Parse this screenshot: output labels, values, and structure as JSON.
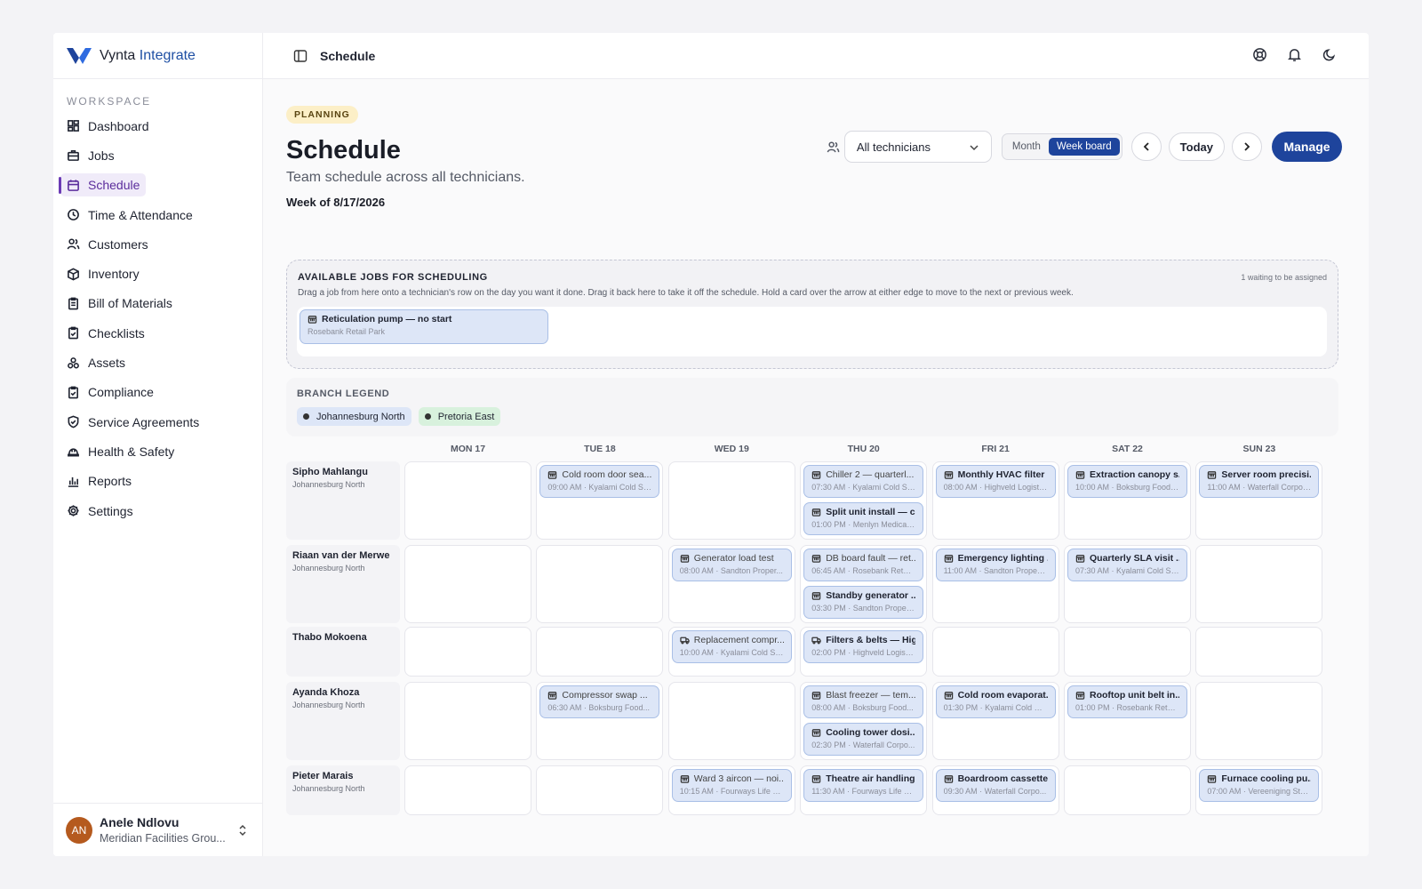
{
  "brand": {
    "name_main": "Vynta",
    "name_accent": "Integrate"
  },
  "sidebar": {
    "section_label": "WORKSPACE",
    "items": [
      {
        "label": "Dashboard",
        "icon": "dashboard-icon"
      },
      {
        "label": "Jobs",
        "icon": "briefcase-icon"
      },
      {
        "label": "Schedule",
        "icon": "calendar-icon",
        "active": true
      },
      {
        "label": "Time & Attendance",
        "icon": "clock-icon"
      },
      {
        "label": "Customers",
        "icon": "users-icon"
      },
      {
        "label": "Inventory",
        "icon": "box-icon"
      },
      {
        "label": "Bill of Materials",
        "icon": "clipboard-list-icon"
      },
      {
        "label": "Checklists",
        "icon": "clipboard-check-icon"
      },
      {
        "label": "Assets",
        "icon": "assets-icon"
      },
      {
        "label": "Compliance",
        "icon": "clipboard-check-icon"
      },
      {
        "label": "Service Agreements",
        "icon": "shield-check-icon"
      },
      {
        "label": "Health & Safety",
        "icon": "hard-hat-icon"
      },
      {
        "label": "Reports",
        "icon": "bar-chart-icon"
      },
      {
        "label": "Settings",
        "icon": "gear-icon"
      }
    ],
    "user": {
      "initials": "AN",
      "name": "Anele Ndlovu",
      "org": "Meridian Facilities Grou..."
    }
  },
  "topbar": {
    "title": "Schedule"
  },
  "page": {
    "badge": "PLANNING",
    "title": "Schedule",
    "subtitle": "Team schedule across all technicians.",
    "week": "Week of 8/17/2026"
  },
  "controls": {
    "technician_filter": "All technicians",
    "view_month": "Month",
    "view_week": "Week board",
    "today": "Today",
    "manage": "Manage"
  },
  "available": {
    "title": "AVAILABLE JOBS FOR SCHEDULING",
    "count": "1 waiting to be assigned",
    "description": "Drag a job from here onto a technician's row on the day you want it done. Drag it back here to take it off the schedule. Hold a card over the arrow at either edge to move to the next or previous week.",
    "jobs": [
      {
        "title": "Reticulation pump — no start",
        "meta": "Rosebank Retail Park"
      }
    ]
  },
  "legend": {
    "title": "BRANCH LEGEND",
    "branches": [
      {
        "name": "Johannesburg North",
        "color": "#dde6f7"
      },
      {
        "name": "Pretoria East",
        "color": "#d8f1dd"
      }
    ]
  },
  "board": {
    "days": [
      "MON 17",
      "TUE 18",
      "WED 19",
      "THU 20",
      "FRI 21",
      "SAT 22",
      "SUN 23"
    ],
    "rows": [
      {
        "name": "Sipho Mahlangu",
        "branch": "Johannesburg North",
        "cells": [
          [],
          [
            {
              "t": "Cold room door sea...",
              "m": "09:00 AM · Kyalami Cold St...",
              "pending": true
            }
          ],
          [],
          [
            {
              "t": "Chiller 2 — quarterl...",
              "m": "07:30 AM · Kyalami Cold St...",
              "pending": true
            },
            {
              "t": "Split unit install — c...",
              "m": "01:00 PM · Menlyn Medical ..."
            }
          ],
          [
            {
              "t": "Monthly HVAC filter ...",
              "m": "08:00 AM · Highveld Logisti..."
            }
          ],
          [
            {
              "t": "Extraction canopy s...",
              "m": "10:00 AM · Boksburg Foods..."
            }
          ],
          [
            {
              "t": "Server room precisi...",
              "m": "11:00 AM · Waterfall Corpor..."
            }
          ]
        ]
      },
      {
        "name": "Riaan van der Merwe",
        "branch": "Johannesburg North",
        "cells": [
          [],
          [],
          [
            {
              "t": "Generator load test",
              "m": "08:00 AM · Sandton Proper...",
              "pending": true
            }
          ],
          [
            {
              "t": "DB board fault — ret...",
              "m": "06:45 AM · Rosebank Retail...",
              "pending": true
            },
            {
              "t": "Standby generator ...",
              "m": "03:30 PM · Sandton Propert..."
            }
          ],
          [
            {
              "t": "Emergency lighting ...",
              "m": "11:00 AM · Sandton Propert..."
            }
          ],
          [
            {
              "t": "Quarterly SLA visit ...",
              "m": "07:30 AM · Kyalami Cold St..."
            }
          ],
          []
        ]
      },
      {
        "name": "Thabo Mokoena",
        "branch": "",
        "cells": [
          [],
          [],
          [
            {
              "t": "Replacement compr...",
              "m": "10:00 AM · Kyalami Cold St...",
              "pending": true,
              "truck": true
            }
          ],
          [
            {
              "t": "Filters & belts — Hig...",
              "m": "02:00 PM · Highveld Logisti...",
              "truck": true
            }
          ],
          [],
          [],
          []
        ]
      },
      {
        "name": "Ayanda Khoza",
        "branch": "Johannesburg North",
        "cells": [
          [],
          [
            {
              "t": "Compressor swap ...",
              "m": "06:30 AM · Boksburg Food...",
              "pending": true
            }
          ],
          [],
          [
            {
              "t": "Blast freezer — tem...",
              "m": "08:00 AM · Boksburg Food...",
              "pending": true
            },
            {
              "t": "Cooling tower dosi...",
              "m": "02:30 PM · Waterfall Corpo..."
            }
          ],
          [
            {
              "t": "Cold room evaporat...",
              "m": "01:30 PM · Kyalami Cold St..."
            }
          ],
          [
            {
              "t": "Rooftop unit belt in...",
              "m": "01:00 PM · Rosebank Retail ..."
            }
          ],
          []
        ]
      },
      {
        "name": "Pieter Marais",
        "branch": "Johannesburg North",
        "cells": [
          [],
          [],
          [
            {
              "t": "Ward 3 aircon — noi...",
              "m": "10:15 AM · Fourways Life H...",
              "pending": true
            }
          ],
          [
            {
              "t": "Theatre air handling...",
              "m": "11:30 AM · Fourways Life H..."
            }
          ],
          [
            {
              "t": "Boardroom cassette...",
              "m": "09:30 AM · Waterfall Corpo..."
            }
          ],
          [],
          [
            {
              "t": "Furnace cooling pu...",
              "m": "07:00 AM · Vereeniging Ste..."
            }
          ]
        ]
      }
    ]
  }
}
